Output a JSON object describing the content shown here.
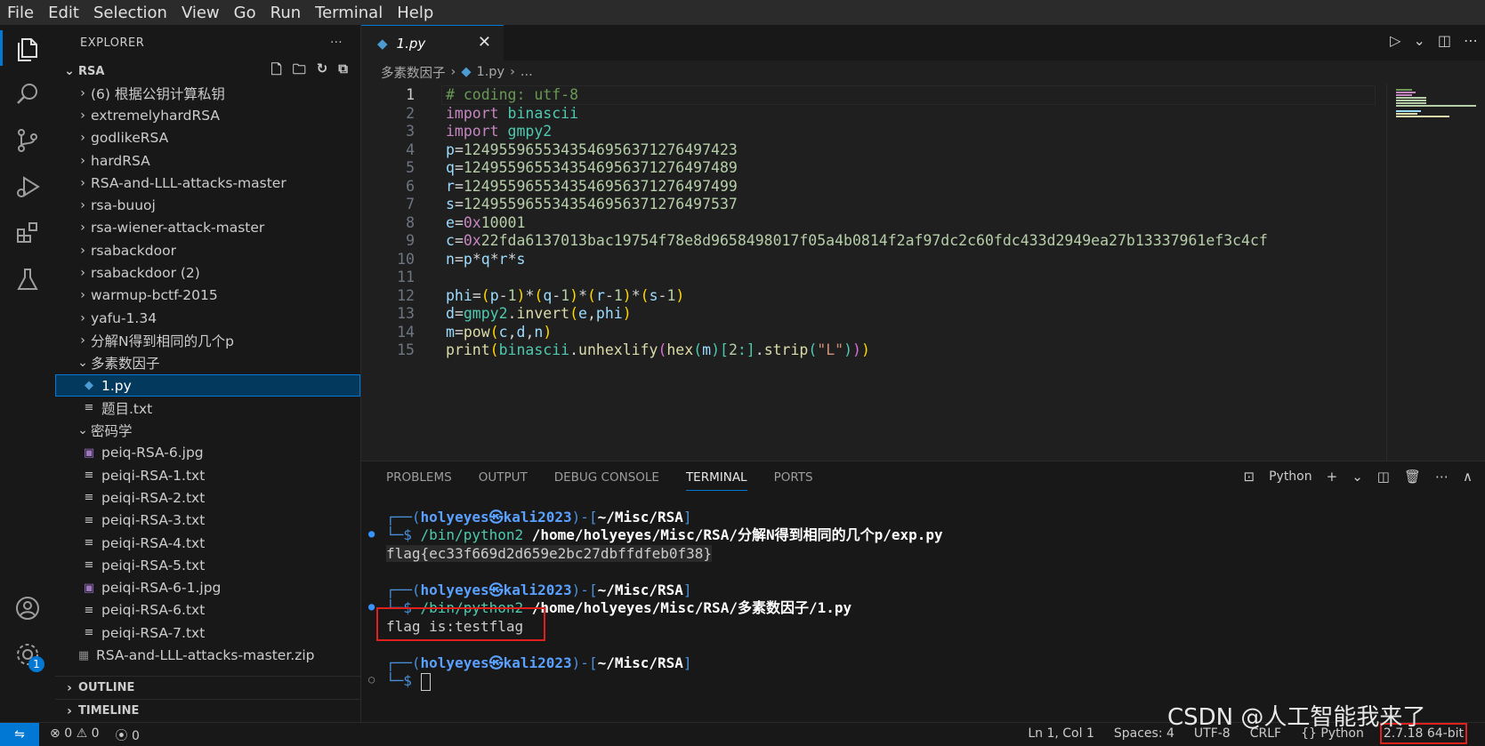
{
  "menu": [
    "File",
    "Edit",
    "Selection",
    "View",
    "Go",
    "Run",
    "Terminal",
    "Help"
  ],
  "activity": {
    "settings_badge": "1"
  },
  "explorer": {
    "title": "EXPLORER",
    "more": "···",
    "root": "RSA",
    "items": [
      {
        "label": "(6) 根据公钥计算私钥",
        "kind": "folder",
        "expanded": false,
        "depth": 1
      },
      {
        "label": "extremelyhardRSA",
        "kind": "folder",
        "expanded": false,
        "depth": 1
      },
      {
        "label": "godlikeRSA",
        "kind": "folder",
        "expanded": false,
        "depth": 1
      },
      {
        "label": "hardRSA",
        "kind": "folder",
        "expanded": false,
        "depth": 1
      },
      {
        "label": "RSA-and-LLL-attacks-master",
        "kind": "folder",
        "expanded": false,
        "depth": 1
      },
      {
        "label": "rsa-buuoj",
        "kind": "folder",
        "expanded": false,
        "depth": 1
      },
      {
        "label": "rsa-wiener-attack-master",
        "kind": "folder",
        "expanded": false,
        "depth": 1
      },
      {
        "label": "rsabackdoor",
        "kind": "folder",
        "expanded": false,
        "depth": 1
      },
      {
        "label": "rsabackdoor (2)",
        "kind": "folder",
        "expanded": false,
        "depth": 1
      },
      {
        "label": "warmup-bctf-2015",
        "kind": "folder",
        "expanded": false,
        "depth": 1
      },
      {
        "label": "yafu-1.34",
        "kind": "folder",
        "expanded": false,
        "depth": 1
      },
      {
        "label": "分解N得到相同的几个p",
        "kind": "folder",
        "expanded": false,
        "depth": 1
      },
      {
        "label": "多素数因子",
        "kind": "folder",
        "expanded": true,
        "depth": 1
      },
      {
        "label": "1.py",
        "kind": "py",
        "depth": 2,
        "selected": true
      },
      {
        "label": "题目.txt",
        "kind": "txt",
        "depth": 2
      },
      {
        "label": "密码学",
        "kind": "folder",
        "expanded": true,
        "depth": 1
      },
      {
        "label": "peiq-RSA-6.jpg",
        "kind": "img",
        "depth": 2
      },
      {
        "label": "peiqi-RSA-1.txt",
        "kind": "txt",
        "depth": 2
      },
      {
        "label": "peiqi-RSA-2.txt",
        "kind": "txt",
        "depth": 2
      },
      {
        "label": "peiqi-RSA-3.txt",
        "kind": "txt",
        "depth": 2
      },
      {
        "label": "peiqi-RSA-4.txt",
        "kind": "txt",
        "depth": 2
      },
      {
        "label": "peiqi-RSA-5.txt",
        "kind": "txt",
        "depth": 2
      },
      {
        "label": "peiqi-RSA-6-1.jpg",
        "kind": "img",
        "depth": 2
      },
      {
        "label": "peiqi-RSA-6.txt",
        "kind": "txt",
        "depth": 2
      },
      {
        "label": "peiqi-RSA-7.txt",
        "kind": "txt",
        "depth": 2
      },
      {
        "label": "RSA-and-LLL-attacks-master.zip",
        "kind": "zip",
        "depth": 1
      }
    ],
    "outline": "OUTLINE",
    "timeline": "TIMELINE"
  },
  "editor": {
    "tab": "1.py",
    "breadcrumb": [
      "多素数因子",
      "1.py",
      "..."
    ],
    "lines": [
      [
        {
          "t": "# coding: utf-8",
          "c": "comment"
        }
      ],
      [
        {
          "t": "import ",
          "c": "kw"
        },
        {
          "t": "binascii",
          "c": "mod"
        }
      ],
      [
        {
          "t": "import ",
          "c": "kw"
        },
        {
          "t": "gmpy2",
          "c": "mod"
        }
      ],
      [
        {
          "t": "p",
          "c": "var"
        },
        {
          "t": "=",
          "c": "op"
        },
        {
          "t": "1249559655343546956371276497423",
          "c": "num"
        }
      ],
      [
        {
          "t": "q",
          "c": "var"
        },
        {
          "t": "=",
          "c": "op"
        },
        {
          "t": "1249559655343546956371276497489",
          "c": "num"
        }
      ],
      [
        {
          "t": "r",
          "c": "var"
        },
        {
          "t": "=",
          "c": "op"
        },
        {
          "t": "1249559655343546956371276497499",
          "c": "num"
        }
      ],
      [
        {
          "t": "s",
          "c": "var"
        },
        {
          "t": "=",
          "c": "op"
        },
        {
          "t": "1249559655343546956371276497537",
          "c": "num"
        }
      ],
      [
        {
          "t": "e",
          "c": "var"
        },
        {
          "t": "=",
          "c": "op"
        },
        {
          "t": "0x",
          "c": "kw"
        },
        {
          "t": "10001",
          "c": "num"
        }
      ],
      [
        {
          "t": "c",
          "c": "var"
        },
        {
          "t": "=",
          "c": "op"
        },
        {
          "t": "0x",
          "c": "kw"
        },
        {
          "t": "22fda6137013bac19754f78e8d9658498017f05a4b0814f2af97dc2c60fdc433d2949ea27b13337961ef3c4cf",
          "c": "num"
        }
      ],
      [
        {
          "t": "n",
          "c": "var"
        },
        {
          "t": "=",
          "c": "op"
        },
        {
          "t": "p",
          "c": "var"
        },
        {
          "t": "*",
          "c": "op"
        },
        {
          "t": "q",
          "c": "var"
        },
        {
          "t": "*",
          "c": "op"
        },
        {
          "t": "r",
          "c": "var"
        },
        {
          "t": "*",
          "c": "op"
        },
        {
          "t": "s",
          "c": "var"
        }
      ],
      [],
      [
        {
          "t": "phi",
          "c": "var"
        },
        {
          "t": "=",
          "c": "op"
        },
        {
          "t": "(",
          "c": "paren"
        },
        {
          "t": "p",
          "c": "var"
        },
        {
          "t": "-",
          "c": "op"
        },
        {
          "t": "1",
          "c": "num"
        },
        {
          "t": ")",
          "c": "paren"
        },
        {
          "t": "*",
          "c": "op"
        },
        {
          "t": "(",
          "c": "paren"
        },
        {
          "t": "q",
          "c": "var"
        },
        {
          "t": "-",
          "c": "op"
        },
        {
          "t": "1",
          "c": "num"
        },
        {
          "t": ")",
          "c": "paren"
        },
        {
          "t": "*",
          "c": "op"
        },
        {
          "t": "(",
          "c": "paren"
        },
        {
          "t": "r",
          "c": "var"
        },
        {
          "t": "-",
          "c": "op"
        },
        {
          "t": "1",
          "c": "num"
        },
        {
          "t": ")",
          "c": "paren"
        },
        {
          "t": "*",
          "c": "op"
        },
        {
          "t": "(",
          "c": "paren"
        },
        {
          "t": "s",
          "c": "var"
        },
        {
          "t": "-",
          "c": "op"
        },
        {
          "t": "1",
          "c": "num"
        },
        {
          "t": ")",
          "c": "paren"
        }
      ],
      [
        {
          "t": "d",
          "c": "var"
        },
        {
          "t": "=",
          "c": "op"
        },
        {
          "t": "gmpy2",
          "c": "mod"
        },
        {
          "t": ".",
          "c": "op"
        },
        {
          "t": "invert",
          "c": "fn"
        },
        {
          "t": "(",
          "c": "paren"
        },
        {
          "t": "e",
          "c": "var"
        },
        {
          "t": ",",
          "c": "op"
        },
        {
          "t": "phi",
          "c": "var"
        },
        {
          "t": ")",
          "c": "paren"
        }
      ],
      [
        {
          "t": "m",
          "c": "var"
        },
        {
          "t": "=",
          "c": "op"
        },
        {
          "t": "pow",
          "c": "fn"
        },
        {
          "t": "(",
          "c": "paren"
        },
        {
          "t": "c",
          "c": "var"
        },
        {
          "t": ",",
          "c": "op"
        },
        {
          "t": "d",
          "c": "var"
        },
        {
          "t": ",",
          "c": "op"
        },
        {
          "t": "n",
          "c": "var"
        },
        {
          "t": ")",
          "c": "paren"
        }
      ],
      [
        {
          "t": "print",
          "c": "fn"
        },
        {
          "t": "(",
          "c": "paren"
        },
        {
          "t": "binascii",
          "c": "mod"
        },
        {
          "t": ".",
          "c": "op"
        },
        {
          "t": "unhexlify",
          "c": "fn"
        },
        {
          "t": "(",
          "c": "paren2"
        },
        {
          "t": "hex",
          "c": "fn"
        },
        {
          "t": "(",
          "c": "mod"
        },
        {
          "t": "m",
          "c": "var"
        },
        {
          "t": ")",
          "c": "mod"
        },
        {
          "t": "[",
          "c": "mod"
        },
        {
          "t": "2",
          "c": "num"
        },
        {
          "t": ":]",
          "c": "mod"
        },
        {
          "t": ".",
          "c": "op"
        },
        {
          "t": "strip",
          "c": "fn"
        },
        {
          "t": "(",
          "c": "mod"
        },
        {
          "t": "\"L\"",
          "c": "str"
        },
        {
          "t": ")",
          "c": "mod"
        },
        {
          "t": ")",
          "c": "paren2"
        },
        {
          "t": ")",
          "c": "paren"
        }
      ]
    ]
  },
  "panel": {
    "tabs": [
      "PROBLEMS",
      "OUTPUT",
      "DEBUG CONSOLE",
      "TERMINAL",
      "PORTS"
    ],
    "active_tab": "TERMINAL",
    "shell": "Python",
    "prompt_user": "holyeyes㉿kali2023",
    "prompt_dir": "~/Misc/RSA",
    "runs": [
      {
        "cmd": "/bin/python2",
        "arg": "/home/holyeyes/Misc/RSA/分解N得到相同的几个p/exp.py",
        "output": "flag{ec33f669d2d659e2bc27dbffdfeb0f38}"
      },
      {
        "cmd": "/bin/python2",
        "arg": "/home/holyeyes/Misc/RSA/多素数因子/1.py",
        "output": "flag is:testflag"
      }
    ]
  },
  "status": {
    "errors": "0",
    "warnings": "0",
    "ports": "0",
    "position": "Ln 1, Col 1",
    "spaces": "Spaces: 4",
    "encoding": "UTF-8",
    "eol": "CRLF",
    "language": "Python",
    "interpreter": "2.7.18 64-bit"
  },
  "watermark": "CSDN @人工智能我来了"
}
